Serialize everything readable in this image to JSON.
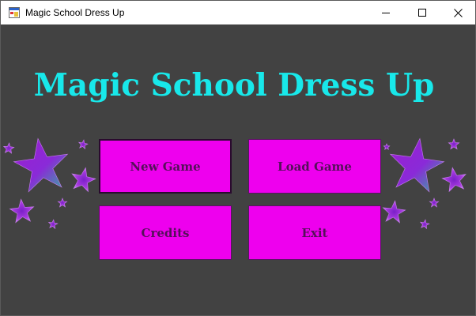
{
  "window": {
    "title": "Magic School Dress Up",
    "controls": {
      "minimize": "minimize-icon",
      "maximize": "maximize-icon",
      "close": "close-icon"
    }
  },
  "game": {
    "title": "Magic School Dress Up"
  },
  "menu": {
    "new_game": "New Game",
    "load_game": "Load Game",
    "credits": "Credits",
    "exit": "Exit"
  },
  "colors": {
    "background": "#424242",
    "title": "#18e8ea",
    "button_fill": "#ee00ee",
    "button_text": "#55105a",
    "star_purple": "#9b1fd0",
    "star_teal": "#2fb89a"
  },
  "decorations": [
    "star-icon"
  ]
}
